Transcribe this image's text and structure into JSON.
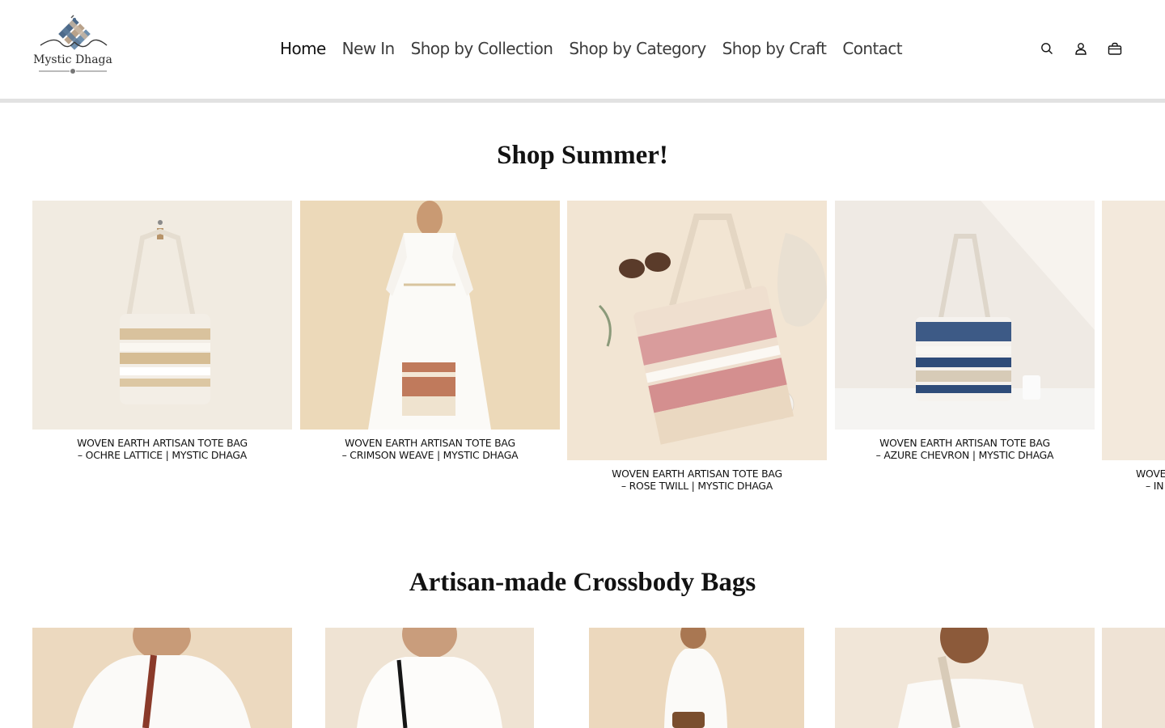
{
  "brand": {
    "name": "Mystic Dhaga",
    "colors": {
      "accent_blue": "#4d6a8a",
      "accent_tan": "#b9a28a",
      "text": "#121212"
    }
  },
  "nav": {
    "items": [
      {
        "label": "Home",
        "active": true
      },
      {
        "label": "New In"
      },
      {
        "label": "Shop by Collection"
      },
      {
        "label": "Shop by Category"
      },
      {
        "label": "Shop by Craft"
      },
      {
        "label": "Contact"
      }
    ]
  },
  "header_icons": [
    "search-icon",
    "account-icon",
    "cart-icon"
  ],
  "summer": {
    "title": "Shop Summer!",
    "products": [
      {
        "line1": "WOVEN EARTH ARTISAN TOTE BAG",
        "line2": "– OCHRE LATTICE | MYSTIC DHAGA"
      },
      {
        "line1": "WOVEN EARTH ARTISAN TOTE BAG",
        "line2": "– CRIMSON WEAVE | MYSTIC DHAGA"
      },
      {
        "line1": "WOVEN EARTH ARTISAN TOTE BAG",
        "line2": "– ROSE TWILL | MYSTIC DHAGA"
      },
      {
        "line1": "WOVEN EARTH ARTISAN TOTE BAG",
        "line2": "– AZURE CHEVRON | MYSTIC DHAGA"
      },
      {
        "line1": "WOVE",
        "line2": "– IN"
      }
    ]
  },
  "crossbody": {
    "title": "Artisan-made Crossbody Bags"
  }
}
